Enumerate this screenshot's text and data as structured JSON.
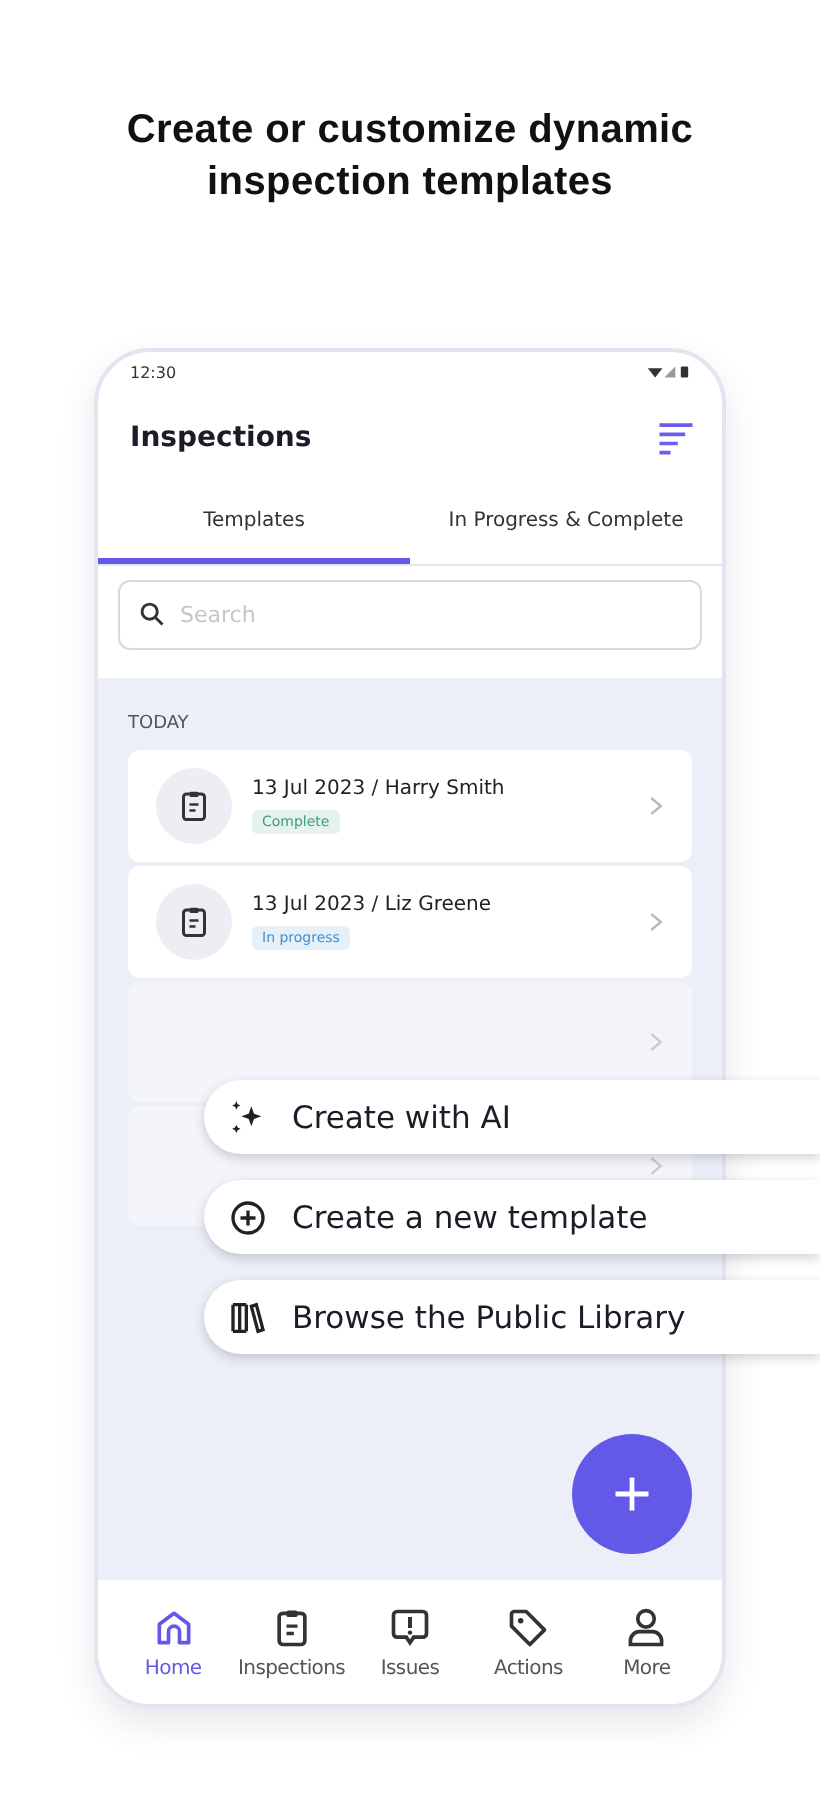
{
  "headline": "Create or customize dynamic inspection templates",
  "status_bar": {
    "time": "12:30"
  },
  "app_bar": {
    "title": "Inspections"
  },
  "tabs": [
    {
      "label": "Templates",
      "selected": true
    },
    {
      "label": "In Progress & Complete",
      "selected": false
    }
  ],
  "search": {
    "placeholder": "Search"
  },
  "section": "TODAY",
  "records": [
    {
      "kind": "record",
      "title": "13 Jul 2023 / Harry Smith",
      "status": "Complete",
      "color": "#3f9d78"
    },
    {
      "kind": "record",
      "title": "13 Jul 2023 / Liz Greene",
      "status": "In progress",
      "color": "#3f8fd0"
    },
    {
      "kind": "obscured"
    },
    {
      "kind": "obscured"
    }
  ],
  "create_menu": [
    {
      "label": "Create with AI"
    },
    {
      "label": "Create a new template"
    },
    {
      "label": "Browse the Public Library"
    }
  ],
  "nav": [
    {
      "label": "Home",
      "selected": true
    },
    {
      "label": "Inspections",
      "selected": false
    },
    {
      "label": "Issues",
      "selected": false
    },
    {
      "label": "Actions",
      "selected": false
    },
    {
      "label": "More",
      "selected": false
    }
  ]
}
